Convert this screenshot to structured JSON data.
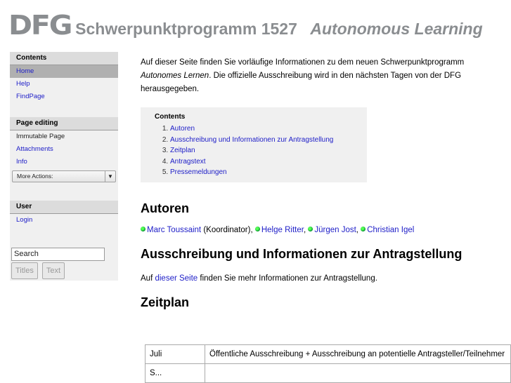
{
  "header": {
    "logo": "DFG",
    "title": "Schwerpunktprogramm 1527",
    "subtitle": "Autonomous Learning"
  },
  "sidebar": {
    "contents": {
      "heading": "Contents",
      "items": [
        {
          "label": "Home",
          "active": true
        },
        {
          "label": "Help"
        },
        {
          "label": "FindPage"
        }
      ]
    },
    "editing": {
      "heading": "Page editing",
      "items": [
        {
          "label": "Immutable Page"
        },
        {
          "label": "Attachments"
        },
        {
          "label": "Info"
        }
      ],
      "more_actions": "More Actions:"
    },
    "user": {
      "heading": "User",
      "items": [
        {
          "label": "Login"
        }
      ]
    },
    "search": {
      "value": "Search",
      "titles_button": "Titles",
      "text_button": "Text"
    }
  },
  "main": {
    "intro_part1": "Auf dieser Seite finden Sie vorläufige Informationen zu dem neuen Schwerpunktprogramm ",
    "intro_em": "Autonomes Lernen",
    "intro_part2": ". Die offizielle Ausschreibung wird in den nächsten Tagen von der DFG herausgegeben.",
    "toc": {
      "title": "Contents",
      "items": [
        "Autoren",
        "Ausschreibung und Informationen zur Antragstellung",
        "Zeitplan",
        "Antragstext",
        "Pressemeldungen"
      ]
    },
    "autoren": {
      "heading": "Autoren",
      "authors": [
        "Marc Toussaint",
        "Helge Ritter",
        "Jürgen Jost",
        "Christian Igel"
      ],
      "coordinator_note": " (Koordinator),"
    },
    "ausschreibung": {
      "heading": "Ausschreibung und Informationen zur Antragstellung",
      "text_before": "Auf ",
      "link": "dieser Seite",
      "text_after": " finden Sie mehr Informationen zur Antragstellung."
    },
    "zeitplan": {
      "heading": "Zeitplan",
      "rows": [
        {
          "month": "Juli",
          "event": "Öffentliche Ausschreibung + Ausschreibung an potentielle Antragsteller/Teilnehmer"
        },
        {
          "month": "S...",
          "event": ""
        }
      ]
    }
  }
}
